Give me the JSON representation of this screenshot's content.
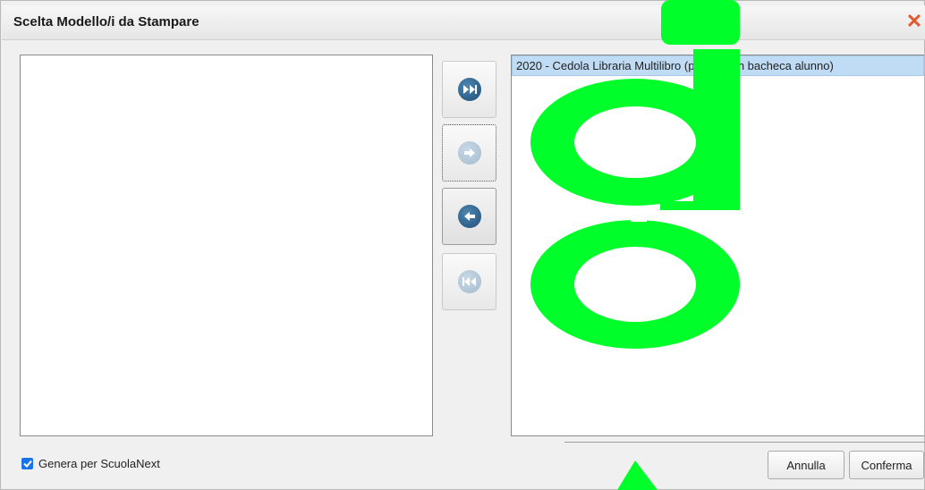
{
  "dialog": {
    "title": "Scelta Modello/i da Stampare",
    "close_icon": "close-icon",
    "accent_color": "#1d4f78",
    "close_color": "#e3582e"
  },
  "available_list": {
    "items": []
  },
  "selected_list": {
    "items": [
      {
        "label": "2020 - Cedola Libraria Multilibro (per invio in bacheca alunno)",
        "selected": true
      }
    ]
  },
  "move_buttons": [
    {
      "icon": "move-all-right-icon",
      "enabled": true
    },
    {
      "icon": "move-right-icon",
      "enabled": false
    },
    {
      "icon": "move-left-icon",
      "enabled": true
    },
    {
      "icon": "move-all-left-icon",
      "enabled": false
    }
  ],
  "footer": {
    "checkbox_label": "Genera per ScuolaNext",
    "checkbox_checked": true,
    "cancel_label": "Annulla",
    "confirm_label": "Conferma"
  },
  "watermark_color": "#00ff2a"
}
